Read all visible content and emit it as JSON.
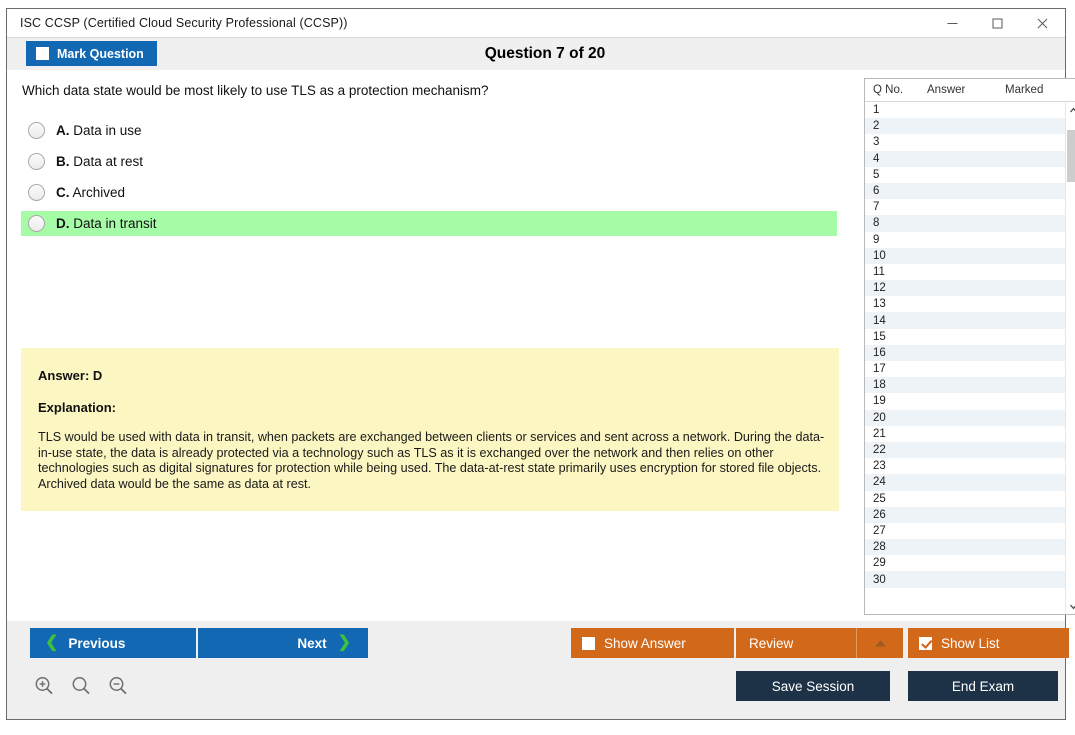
{
  "window": {
    "title": "ISC CCSP (Certified Cloud Security Professional (CCSP))",
    "minimize_label": "—",
    "maximize_label": "□",
    "close_label": "✕"
  },
  "header": {
    "mark_question_label": "Mark Question",
    "mark_question_checked": false,
    "question_title": "Question 7 of 20"
  },
  "question": {
    "text": "Which data state would be most likely to use TLS as a protection mechanism?",
    "options": [
      {
        "letter": "A.",
        "text": "Data in use",
        "correct": false,
        "selected": false
      },
      {
        "letter": "B.",
        "text": "Data at rest",
        "correct": false,
        "selected": false
      },
      {
        "letter": "C.",
        "text": "Archived",
        "correct": false,
        "selected": false
      },
      {
        "letter": "D.",
        "text": "Data in transit",
        "correct": true,
        "selected": false
      }
    ]
  },
  "answer_box": {
    "answer_label": "Answer: D",
    "explanation_label": "Explanation:",
    "explanation_text": "TLS would be used with data in transit, when packets are exchanged between clients or services and sent across a network. During the data-in-use state, the data is already protected via a technology such as TLS as it is exchanged over the network and then relies on other technologies such as digital signatures for protection while being used. The data-at-rest state primarily uses encryption for stored file objects. Archived data would be the same as data at rest."
  },
  "question_list": {
    "columns": [
      "Q No.",
      "Answer",
      "Marked"
    ],
    "rows": [
      {
        "no": "1",
        "answer": "",
        "marked": ""
      },
      {
        "no": "2",
        "answer": "",
        "marked": ""
      },
      {
        "no": "3",
        "answer": "",
        "marked": ""
      },
      {
        "no": "4",
        "answer": "",
        "marked": ""
      },
      {
        "no": "5",
        "answer": "",
        "marked": ""
      },
      {
        "no": "6",
        "answer": "",
        "marked": ""
      },
      {
        "no": "7",
        "answer": "",
        "marked": ""
      },
      {
        "no": "8",
        "answer": "",
        "marked": ""
      },
      {
        "no": "9",
        "answer": "",
        "marked": ""
      },
      {
        "no": "10",
        "answer": "",
        "marked": ""
      },
      {
        "no": "11",
        "answer": "",
        "marked": ""
      },
      {
        "no": "12",
        "answer": "",
        "marked": ""
      },
      {
        "no": "13",
        "answer": "",
        "marked": ""
      },
      {
        "no": "14",
        "answer": "",
        "marked": ""
      },
      {
        "no": "15",
        "answer": "",
        "marked": ""
      },
      {
        "no": "16",
        "answer": "",
        "marked": ""
      },
      {
        "no": "17",
        "answer": "",
        "marked": ""
      },
      {
        "no": "18",
        "answer": "",
        "marked": ""
      },
      {
        "no": "19",
        "answer": "",
        "marked": ""
      },
      {
        "no": "20",
        "answer": "",
        "marked": ""
      },
      {
        "no": "21",
        "answer": "",
        "marked": ""
      },
      {
        "no": "22",
        "answer": "",
        "marked": ""
      },
      {
        "no": "23",
        "answer": "",
        "marked": ""
      },
      {
        "no": "24",
        "answer": "",
        "marked": ""
      },
      {
        "no": "25",
        "answer": "",
        "marked": ""
      },
      {
        "no": "26",
        "answer": "",
        "marked": ""
      },
      {
        "no": "27",
        "answer": "",
        "marked": ""
      },
      {
        "no": "28",
        "answer": "",
        "marked": ""
      },
      {
        "no": "29",
        "answer": "",
        "marked": ""
      },
      {
        "no": "30",
        "answer": "",
        "marked": ""
      }
    ]
  },
  "bottom_bar": {
    "previous_label": "Previous",
    "next_label": "Next",
    "show_answer_label": "Show Answer",
    "show_answer_checked": false,
    "review_label": "Review",
    "show_list_label": "Show List",
    "show_list_checked": true,
    "save_session_label": "Save Session",
    "end_exam_label": "End Exam"
  },
  "colors": {
    "accent_blue": "#1268b3",
    "accent_orange": "#d2691a",
    "navy": "#1e3247",
    "correct_green": "#a6fba6",
    "answer_yellow": "#fcf6c3",
    "chevron_green": "#3cc13c"
  }
}
